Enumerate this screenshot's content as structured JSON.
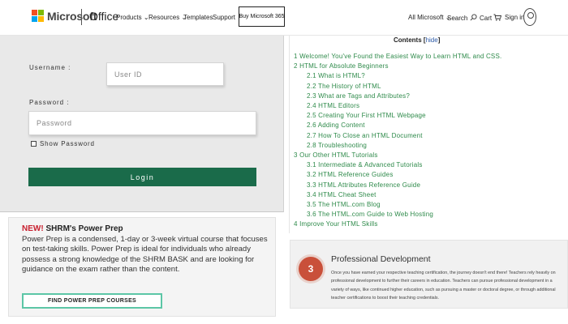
{
  "header": {
    "brand": "Microsoft",
    "product": "Office",
    "nav": {
      "products": "Products",
      "resources": "Resources",
      "templates": "Templates",
      "support": "Support"
    },
    "buy_label": "Buy Microsoft 365",
    "all_microsoft": "All Microsoft",
    "search": "Search",
    "cart": "Cart",
    "sign_in": "Sign in",
    "logo_colors": [
      "#f25022",
      "#7fba00",
      "#00a4ef",
      "#ffb900"
    ]
  },
  "login": {
    "username_label": "Username :",
    "username_placeholder": "User ID",
    "password_label": "Password :",
    "password_placeholder": "Password",
    "show_password_label": "Show Password",
    "show_password_checked": false,
    "login_button": "Login",
    "button_color": "#1a6b4a"
  },
  "toc": {
    "title": "Contents",
    "hide_link": "hide",
    "items": [
      {
        "text": "1 Welcome! You've Found the Easiest Way to Learn HTML and CSS.",
        "level": 1
      },
      {
        "text": "2 HTML for Absolute Beginners",
        "level": 1
      },
      {
        "text": "2.1 What is HTML?",
        "level": 2
      },
      {
        "text": "2.2 The History of HTML",
        "level": 2
      },
      {
        "text": "2.3 What are Tags and Attributes?",
        "level": 2
      },
      {
        "text": "2.4 HTML Editors",
        "level": 2
      },
      {
        "text": "2.5 Creating Your First HTML Webpage",
        "level": 2
      },
      {
        "text": "2.6 Adding Content",
        "level": 2
      },
      {
        "text": "2.7 How To Close an HTML Document",
        "level": 2
      },
      {
        "text": "2.8 Troubleshooting",
        "level": 2
      },
      {
        "text": "3 Our Other HTML Tutorials",
        "level": 1
      },
      {
        "text": "3.1 Intermediate & Advanced Tutorials",
        "level": 2
      },
      {
        "text": "3.2 HTML Reference Guides",
        "level": 2
      },
      {
        "text": "3.3 HTML Attributes Reference Guide",
        "level": 2
      },
      {
        "text": "3.4 HTML Cheat Sheet",
        "level": 2
      },
      {
        "text": "3.5 The HTML.com Blog",
        "level": 2
      },
      {
        "text": "3.6 The HTML.com Guide to Web Hosting",
        "level": 2
      },
      {
        "text": "4 Improve Your HTML Skills",
        "level": 1
      }
    ]
  },
  "shrm": {
    "new_label": "NEW!",
    "heading": "SHRM's Power Prep",
    "body": "Power Prep is a condensed, 1-day or 3-week virtual course that focuses on test-taking skills. Power Prep is ideal for individuals who already possess a strong knowledge of the SHRM BASK and are looking for guidance on the exam rather than the content.",
    "button_label": "FIND POWER PREP COURSES"
  },
  "professional_dev": {
    "number": "3",
    "title": "Professional Development",
    "body": "Once you have earned your respective teaching certification, the journey doesn't end there! Teachers rely heavily on professional development to further their careers in education. Teachers can pursue professional development in a variety of ways, like continued higher education, such as pursuing a master or doctoral degree, or through additional teacher certifications to boost their teaching credentials."
  }
}
